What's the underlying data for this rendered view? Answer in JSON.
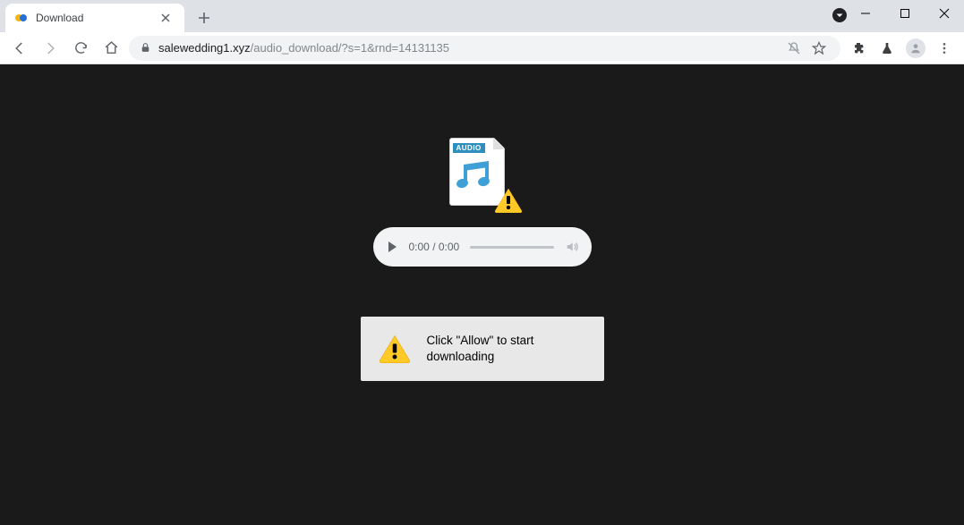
{
  "tab": {
    "title": "Download"
  },
  "address": {
    "host": "salewedding1.xyz",
    "path": "/audio_download/?s=1&rnd=14131135"
  },
  "audio_file": {
    "tag": "AUDIO"
  },
  "player": {
    "time": "0:00 / 0:00"
  },
  "message": {
    "text": "Click \"Allow\" to start downloading"
  }
}
